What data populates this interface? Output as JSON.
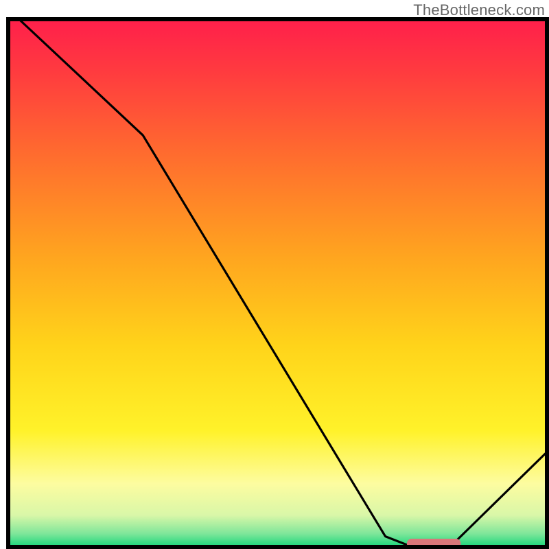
{
  "watermark": "TheBottleneck.com",
  "chart_data": {
    "type": "line",
    "title": "",
    "xlabel": "",
    "ylabel": "",
    "xlim": [
      0,
      100
    ],
    "ylim": [
      0,
      100
    ],
    "curve": [
      {
        "x": 2,
        "y": 100
      },
      {
        "x": 25,
        "y": 78
      },
      {
        "x": 70,
        "y": 2
      },
      {
        "x": 75,
        "y": 0
      },
      {
        "x": 82,
        "y": 0
      },
      {
        "x": 100,
        "y": 18
      }
    ],
    "marker": {
      "x_start": 74,
      "x_end": 84,
      "y": 0,
      "color": "#d9777a"
    },
    "gradient_stops": [
      {
        "offset": 0.0,
        "color": "#ff1f4b"
      },
      {
        "offset": 0.1,
        "color": "#ff3b3f"
      },
      {
        "offset": 0.25,
        "color": "#ff6a2f"
      },
      {
        "offset": 0.45,
        "color": "#ffa51f"
      },
      {
        "offset": 0.62,
        "color": "#ffd41a"
      },
      {
        "offset": 0.78,
        "color": "#fff22a"
      },
      {
        "offset": 0.88,
        "color": "#fdfca0"
      },
      {
        "offset": 0.94,
        "color": "#d9f7a8"
      },
      {
        "offset": 0.975,
        "color": "#7ee69a"
      },
      {
        "offset": 1.0,
        "color": "#17d67a"
      }
    ],
    "border_color": "#000000",
    "border_width": 6
  }
}
